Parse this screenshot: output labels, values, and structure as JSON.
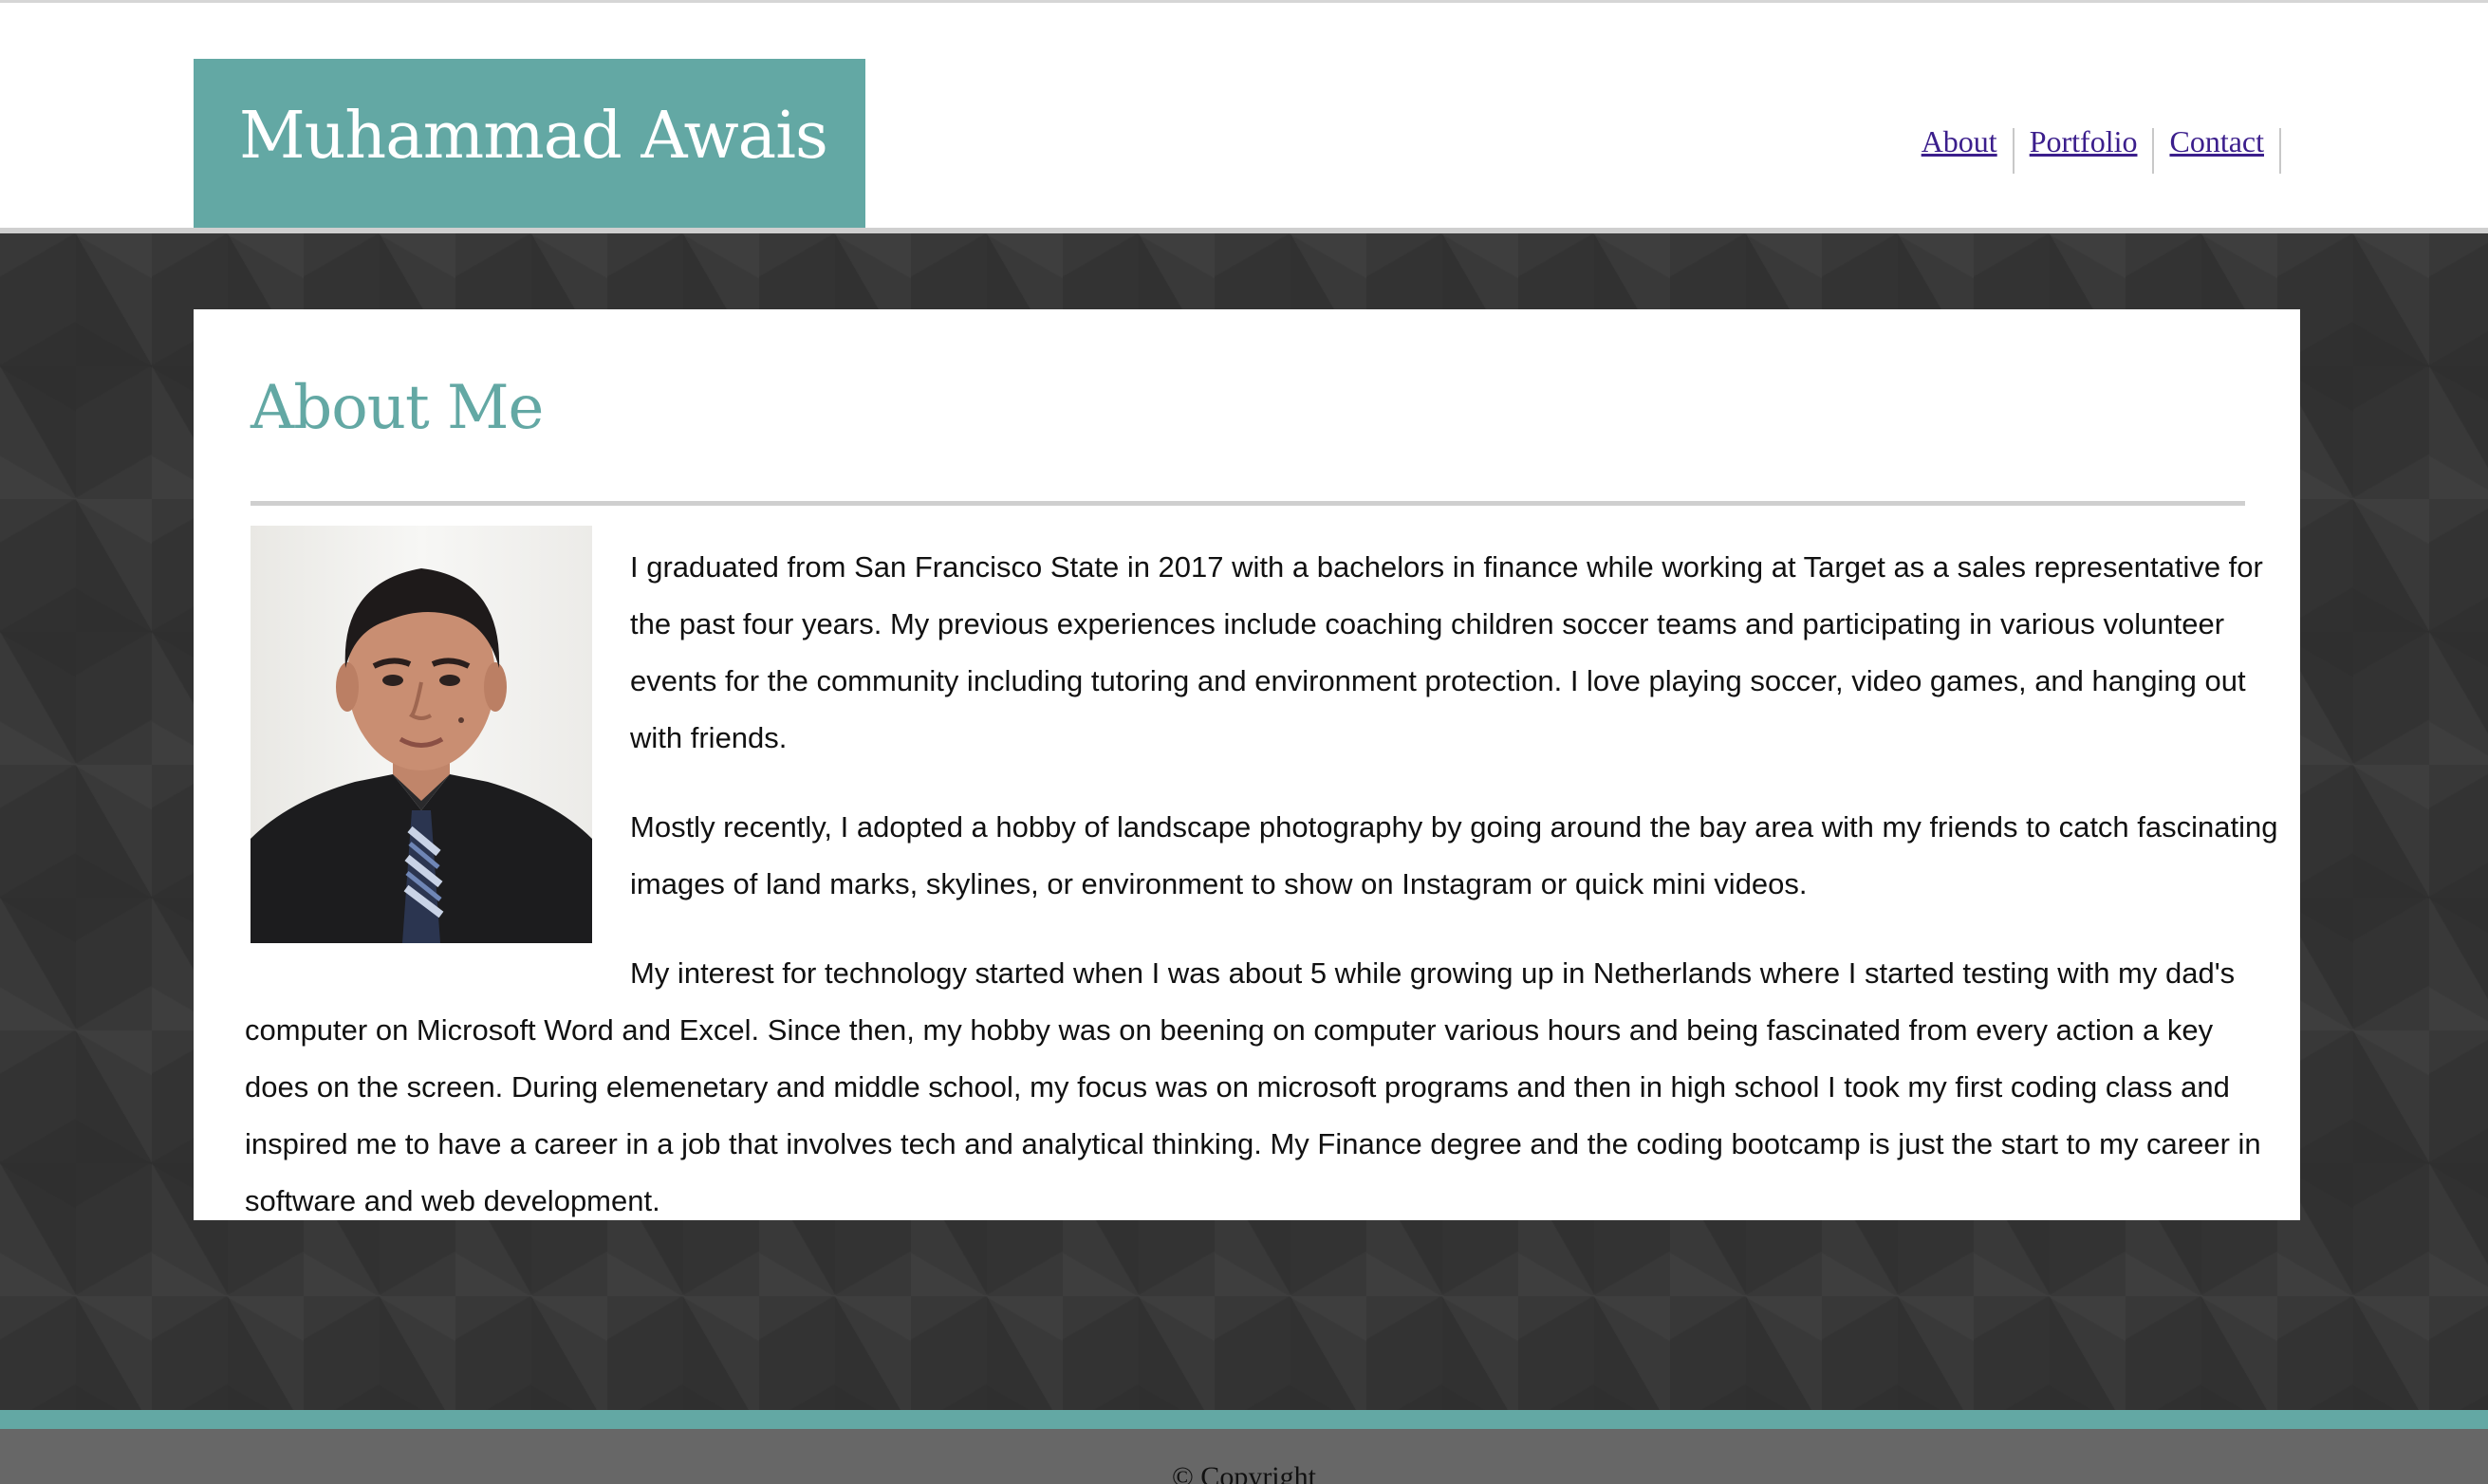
{
  "header": {
    "site_name": "Muhammad Awais",
    "brand_color": "#63a8a4",
    "nav": [
      {
        "label": "About"
      },
      {
        "label": "Portfolio"
      },
      {
        "label": "Contact"
      }
    ],
    "link_color": "#3b1e8c"
  },
  "main": {
    "section_title": "About Me",
    "photo_alt": "profile-photo",
    "paragraphs": [
      "I graduated from San Francisco State in 2017 with a bachelors in finance while working at Target as a sales representative for the past four years. My previous experiences include coaching children soccer teams and participating in various volunteer events for the community including tutoring and environment protection. I love playing soccer, video games, and hanging out with friends.",
      "Mostly recently, I adopted a hobby of landscape photography by going around the bay area with my friends to catch fascinating images of land marks, skylines, or environment to show on Instagram or quick mini videos.",
      "My interest for technology started when I was about 5 while growing up in Netherlands where I started testing with my dad's computer on Microsoft Word and Excel. Since then, my hobby was on beening on computer various hours and being fascinated from every action a key does on the screen. During elemenetary and middle school, my focus was on microsoft programs and then in high school I took my first coding class and inspired me to have a career in a job that involves tech and analytical thinking. My Finance degree and the coding bootcamp is just the start to my career in software and web development."
    ]
  },
  "footer": {
    "text": "© Copyright",
    "stripe_color": "#63a8a4",
    "background_color": "#676767"
  }
}
